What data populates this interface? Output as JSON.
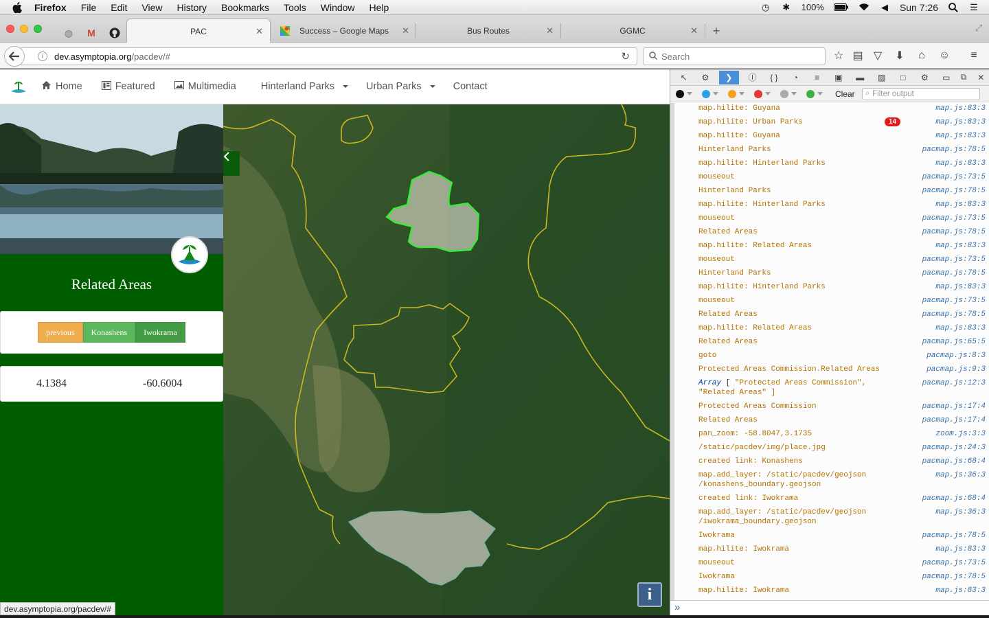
{
  "menubar": {
    "app": "Firefox",
    "items": [
      "File",
      "Edit",
      "View",
      "History",
      "Bookmarks",
      "Tools",
      "Window",
      "Help"
    ],
    "battery": "100%",
    "clock": "Sun 7:26"
  },
  "tabs": {
    "active": {
      "title": "PAC"
    },
    "others": [
      {
        "title": "Success – Google Maps"
      },
      {
        "title": "Bus Routes"
      },
      {
        "title": "GGMC"
      }
    ],
    "new_tab": "+"
  },
  "navbar": {
    "url_domain": "dev.asymptopia.org",
    "url_path": "/pacdev/#",
    "search_placeholder": "Search"
  },
  "site": {
    "nav": [
      {
        "label": "Home",
        "icon": "home-icon"
      },
      {
        "label": "Featured",
        "icon": "featured-icon"
      },
      {
        "label": "Multimedia",
        "icon": "picture-icon"
      },
      {
        "label": "Hinterland Parks",
        "dropdown": true
      },
      {
        "label": "Urban Parks",
        "dropdown": true
      },
      {
        "label": "Contact"
      }
    ],
    "sidebar": {
      "heading": "Related Areas",
      "buttons": {
        "previous": "previous",
        "first": "Konashens",
        "second": "Iwokrama"
      },
      "coords": {
        "lat": "4.1384",
        "lng": "-60.6004"
      }
    },
    "map": {
      "info_label": "i"
    }
  },
  "statusbar": {
    "url": "dev.asymptopia.org/pacdev/#"
  },
  "devtools": {
    "clear_label": "Clear",
    "filter_placeholder": "Filter output",
    "badge_count": "14",
    "logs": [
      {
        "msg": "map.hilite: Guyana",
        "src": "map.js:83:3"
      },
      {
        "msg": "map.hilite: Urban Parks",
        "src": "map.js:83:3"
      },
      {
        "msg": "map.hilite: Guyana",
        "src": "map.js:83:3"
      },
      {
        "msg": "Hinterland Parks",
        "src": "pacmap.js:78:5"
      },
      {
        "msg": "map.hilite: Hinterland Parks",
        "src": "map.js:83:3"
      },
      {
        "msg": "mouseout",
        "src": "pacmap.js:73:5"
      },
      {
        "msg": "Hinterland Parks",
        "src": "pacmap.js:78:5"
      },
      {
        "msg": "map.hilite: Hinterland Parks",
        "src": "map.js:83:3"
      },
      {
        "msg": "mouseout",
        "src": "pacmap.js:73:5"
      },
      {
        "msg": "Related Areas",
        "src": "pacmap.js:78:5"
      },
      {
        "msg": "map.hilite: Related Areas",
        "src": "map.js:83:3"
      },
      {
        "msg": "mouseout",
        "src": "pacmap.js:73:5"
      },
      {
        "msg": "Hinterland Parks",
        "src": "pacmap.js:78:5"
      },
      {
        "msg": "map.hilite: Hinterland Parks",
        "src": "map.js:83:3"
      },
      {
        "msg": "mouseout",
        "src": "pacmap.js:73:5"
      },
      {
        "msg": "Related Areas",
        "src": "pacmap.js:78:5"
      },
      {
        "msg": "map.hilite: Related Areas",
        "src": "map.js:83:3"
      },
      {
        "msg": "Related Areas",
        "src": "pacmap.js:65:5"
      },
      {
        "msg": "goto",
        "src": "pacmap.js:8:3"
      },
      {
        "msg": "Protected Areas Commission.Related Areas",
        "src": "pacmap.js:9:3"
      },
      {
        "msg": "\"Protected Areas Commission\",\n\"Related Areas\" ]",
        "prefix": "Array",
        "bracket": " [ ",
        "src": "pacmap.js:12:3"
      },
      {
        "msg": "Protected Areas Commission",
        "src": "pacmap.js:17:4"
      },
      {
        "msg": "Related Areas",
        "src": "pacmap.js:17:4"
      },
      {
        "msg": "pan_zoom: -58.8047,3.1735",
        "src": "zoom.js:3:3"
      },
      {
        "msg": "/static/pacdev/img/place.jpg",
        "src": "pacmap.js:24:3"
      },
      {
        "msg": "created link: Konashens",
        "src": "pacmap.js:68:4"
      },
      {
        "msg": "map.add_layer: /static/pacdev/geojson\n/konashens_boundary.geojson",
        "src": "map.js:36:3"
      },
      {
        "msg": "created link: Iwokrama",
        "src": "pacmap.js:68:4"
      },
      {
        "msg": "map.add_layer: /static/pacdev/geojson\n/iwokrama_boundary.geojson",
        "src": "map.js:36:3"
      },
      {
        "msg": "Iwokrama",
        "src": "pacmap.js:78:5"
      },
      {
        "msg": "map.hilite: Iwokrama",
        "src": "map.js:83:3"
      },
      {
        "msg": "mouseout",
        "src": "pacmap.js:73:5"
      },
      {
        "msg": "Iwokrama",
        "src": "pacmap.js:78:5"
      },
      {
        "msg": "map.hilite: Iwokrama",
        "src": "map.js:83:3"
      }
    ],
    "input_prompt": "»"
  },
  "colors": {
    "sidebar_green": "#005e00",
    "boundary_yellow": "#c8b820",
    "highlight_green": "#33ee33",
    "log_orange": "#b27205",
    "log_source_blue": "#3871a7"
  }
}
